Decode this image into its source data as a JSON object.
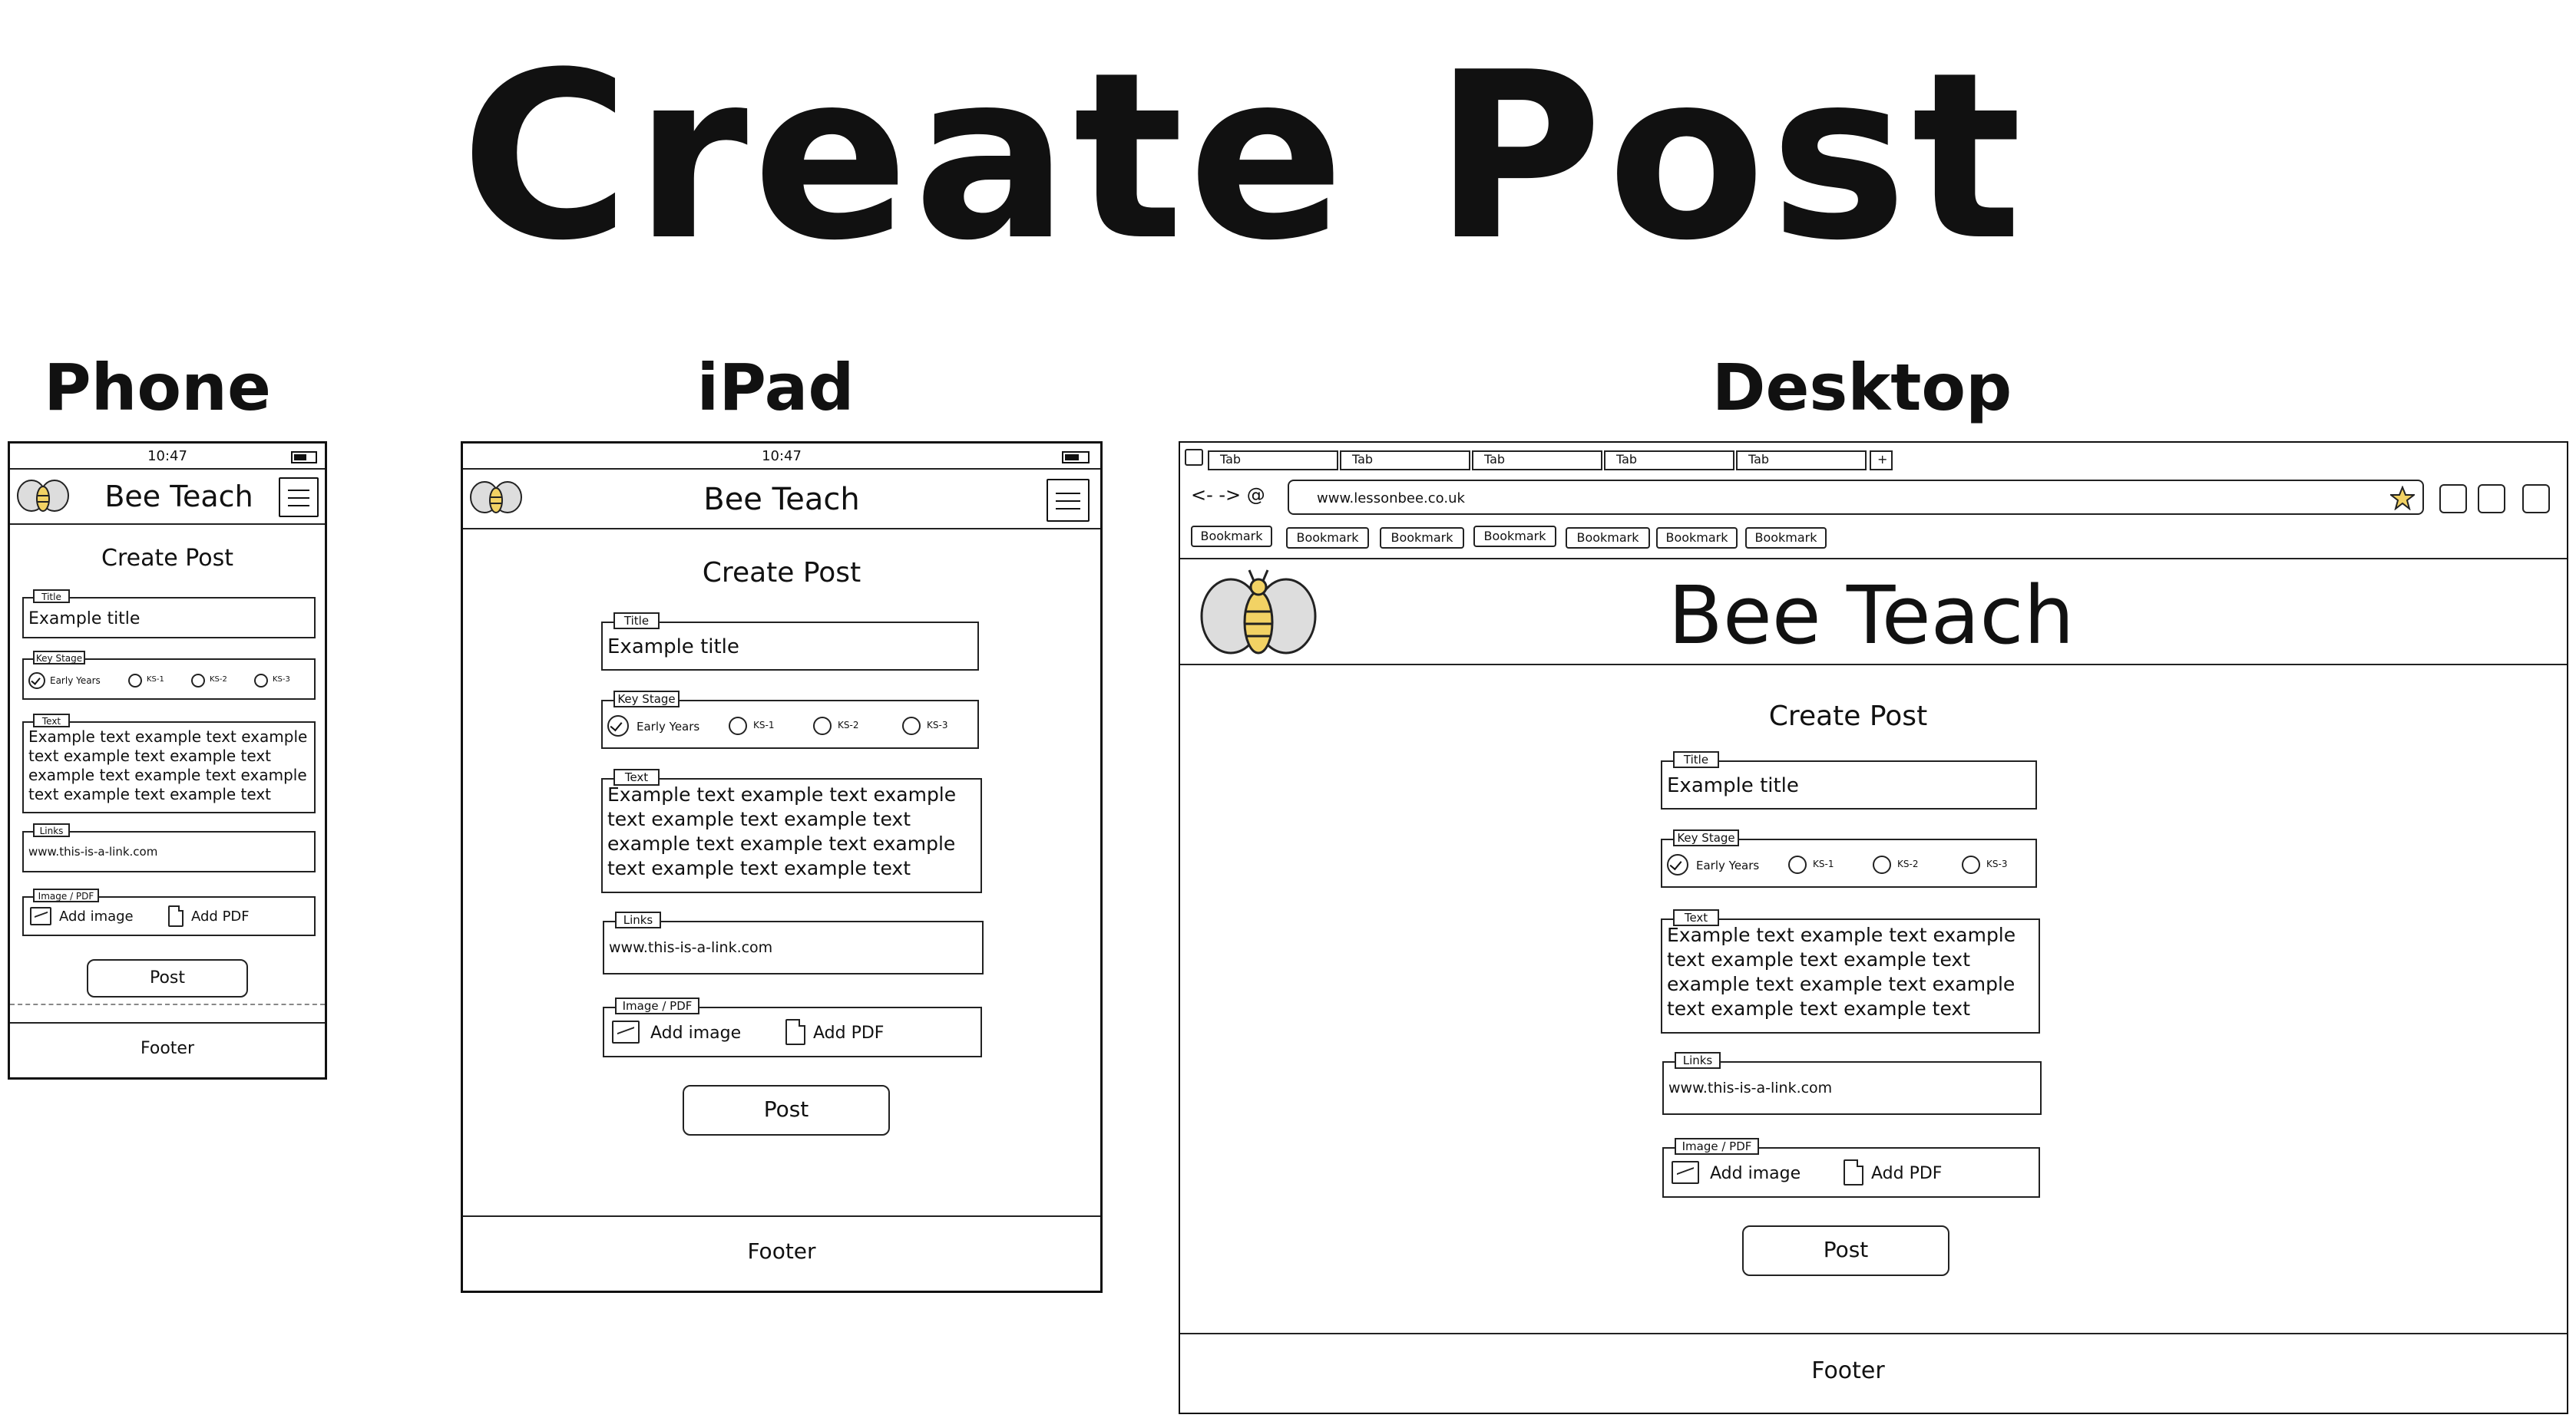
{
  "heading": "Create Post",
  "sections": {
    "phone": "Phone",
    "ipad": "iPad",
    "desktop": "Desktop"
  },
  "status_time": "10:47",
  "brand": "Bee Teach",
  "form": {
    "title": "Create Post",
    "title_legend": "Title",
    "title_value": "Example title",
    "keystage_legend": "Key Stage",
    "keystages": [
      "Early Years",
      "KS-1",
      "KS-2",
      "KS-3"
    ],
    "selected_keystage": "Early Years",
    "text_legend": "Text",
    "text_value": "Example text example text example text example text example text example text example text example text example text example text",
    "links_legend": "Links",
    "links_value": "www.this-is-a-link.com",
    "media_legend": "Image / PDF",
    "add_image": "Add image",
    "add_pdf": "Add PDF",
    "post_button": "Post"
  },
  "footer": "Footer",
  "browser": {
    "tabs": [
      "Tab",
      "Tab",
      "Tab",
      "Tab",
      "Tab"
    ],
    "new_tab": "+",
    "nav": "<- -> @",
    "url": "www.lessonbee.co.uk",
    "bookmarks": [
      "Bookmark",
      "Bookmark",
      "Bookmark",
      "Bookmark",
      "Bookmark",
      "Bookmark",
      "Bookmark"
    ]
  },
  "icons": {
    "bee": "bee-logo-icon",
    "menu": "hamburger-menu-icon",
    "star": "star-icon",
    "image": "image-icon",
    "pdf": "file-icon",
    "battery": "battery-icon"
  },
  "colors": {
    "bee_yellow": "#f2d264",
    "ink": "#111111"
  }
}
